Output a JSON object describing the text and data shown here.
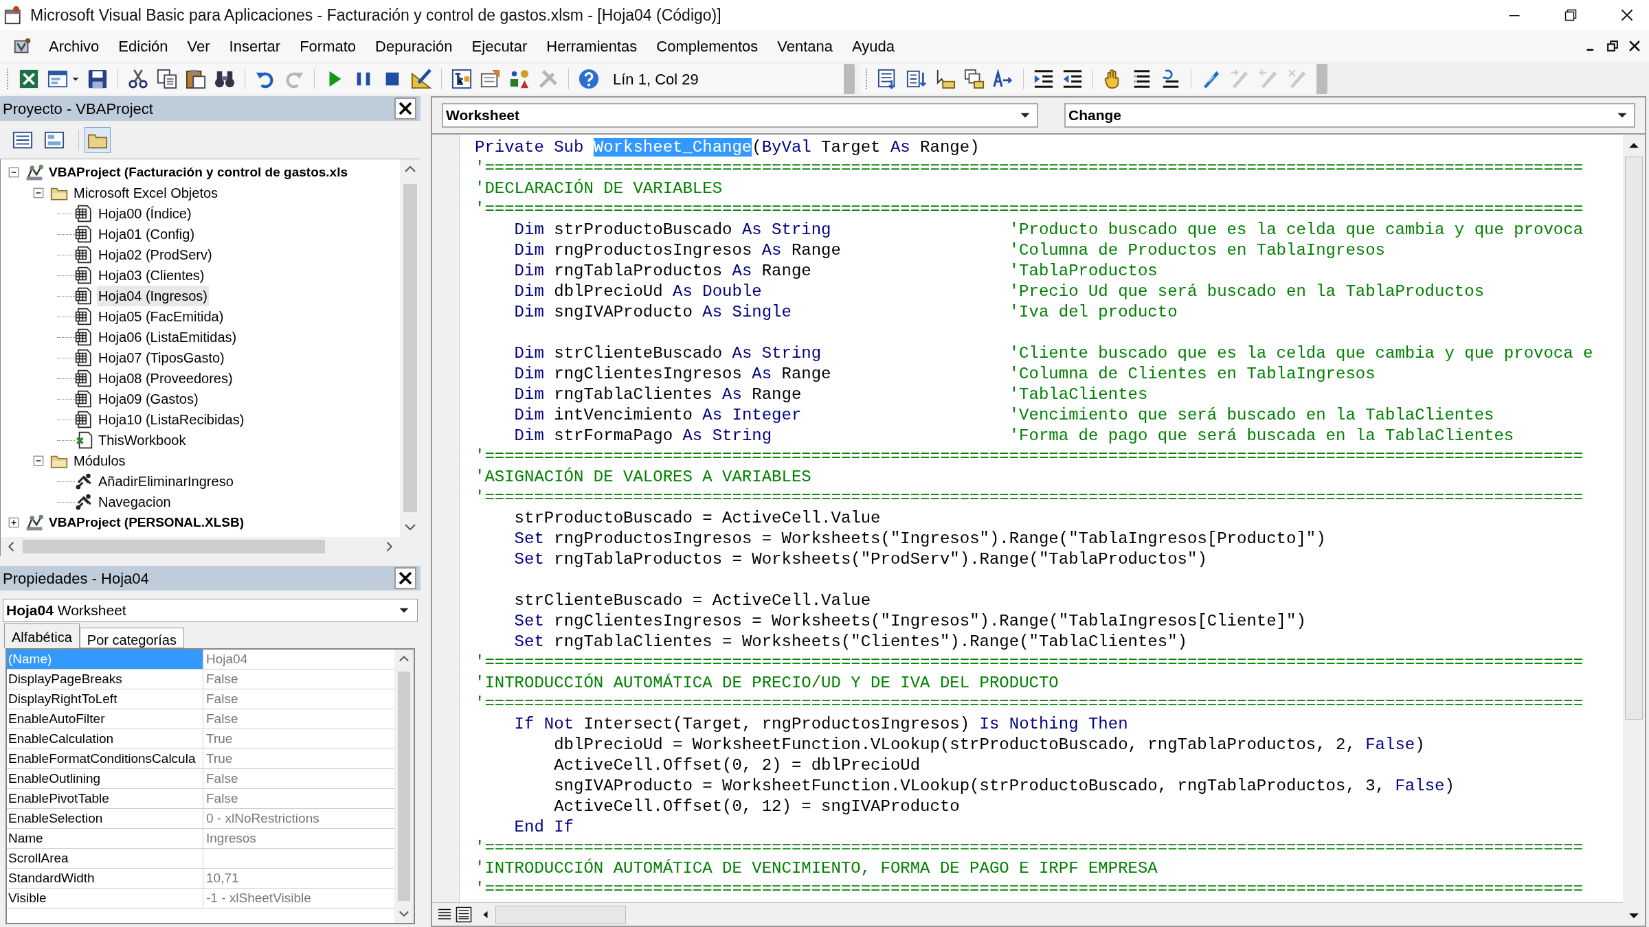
{
  "window": {
    "title": "Microsoft Visual Basic para Aplicaciones - Facturación y control de gastos.xlsm - [Hoja04 (Código)]"
  },
  "menu": [
    "Archivo",
    "Edición",
    "Ver",
    "Insertar",
    "Formato",
    "Depuración",
    "Ejecutar",
    "Herramientas",
    "Complementos",
    "Ventana",
    "Ayuda"
  ],
  "toolbar": {
    "standard": [
      {
        "disabled": false
      },
      {
        "disabled": false
      },
      {
        "disabled": false
      },
      {
        "disabled": false
      },
      {
        "disabled": false
      },
      {
        "disabled": false
      },
      {
        "disabled": false
      },
      {
        "disabled": false
      },
      {
        "disabled": true
      },
      {
        "disabled": false
      },
      {
        "disabled": false
      },
      {
        "disabled": false
      },
      {
        "disabled": false
      },
      {
        "disabled": false
      },
      {
        "disabled": false
      },
      {
        "disabled": false
      },
      {
        "disabled": true
      },
      {
        "disabled": false
      }
    ],
    "position": "Lín 1, Col 29",
    "edit": [
      {
        "disabled": false
      },
      {
        "disabled": false
      },
      {
        "disabled": false
      },
      {
        "disabled": false
      },
      {
        "disabled": false
      },
      {
        "disabled": false
      },
      {
        "disabled": false
      },
      {
        "disabled": false
      },
      {
        "disabled": false
      },
      {
        "disabled": false
      },
      {
        "disabled": false
      },
      {
        "disabled": true
      },
      {
        "disabled": true
      },
      {
        "disabled": true
      }
    ]
  },
  "project": {
    "title": "Proyecto - VBAProject",
    "buttons": [
      {
        "selected": false
      },
      {
        "selected": false
      },
      {
        "selected": true
      }
    ],
    "tree": [
      {
        "kind": "project",
        "label": "VBAProject (Facturación y control de gastos.xls",
        "expanded": true,
        "selected": false,
        "children": [
          {
            "kind": "folder",
            "label": "Microsoft Excel Objetos",
            "expanded": true,
            "selected": false,
            "children": [
              {
                "kind": "sheet",
                "label": "Hoja00 (Índice)",
                "selected": false
              },
              {
                "kind": "sheet",
                "label": "Hoja01 (Config)",
                "selected": false
              },
              {
                "kind": "sheet",
                "label": "Hoja02 (ProdServ)",
                "selected": false
              },
              {
                "kind": "sheet",
                "label": "Hoja03 (Clientes)",
                "selected": false
              },
              {
                "kind": "sheet",
                "label": "Hoja04 (Ingresos)",
                "selected": true
              },
              {
                "kind": "sheet",
                "label": "Hoja05 (FacEmitida)",
                "selected": false
              },
              {
                "kind": "sheet",
                "label": "Hoja06 (ListaEmitidas)",
                "selected": false
              },
              {
                "kind": "sheet",
                "label": "Hoja07 (TiposGasto)",
                "selected": false
              },
              {
                "kind": "sheet",
                "label": "Hoja08 (Proveedores)",
                "selected": false
              },
              {
                "kind": "sheet",
                "label": "Hoja09 (Gastos)",
                "selected": false
              },
              {
                "kind": "sheet",
                "label": "Hoja10 (ListaRecibidas)",
                "selected": false
              },
              {
                "kind": "workbook",
                "label": "ThisWorkbook",
                "selected": false
              }
            ]
          },
          {
            "kind": "folder",
            "label": "Módulos",
            "expanded": true,
            "selected": false,
            "children": [
              {
                "kind": "module",
                "label": "AñadirEliminarIngreso",
                "selected": false
              },
              {
                "kind": "module",
                "label": "Navegacion",
                "selected": false
              }
            ]
          }
        ]
      },
      {
        "kind": "project",
        "label": "VBAProject (PERSONAL.XLSB)",
        "expanded": false,
        "selected": false
      }
    ]
  },
  "properties": {
    "title": "Propiedades - Hoja04",
    "object": {
      "name": "Hoja04",
      "type": "Worksheet"
    },
    "tabs": [
      {
        "label": "Alfabética",
        "selected": true
      },
      {
        "label": "Por categorías",
        "selected": false
      }
    ],
    "rows": [
      {
        "name": "(Name)",
        "value": "Hoja04",
        "selected": true
      },
      {
        "name": "DisplayPageBreaks",
        "value": "False",
        "selected": false
      },
      {
        "name": "DisplayRightToLeft",
        "value": "False",
        "selected": false
      },
      {
        "name": "EnableAutoFilter",
        "value": "False",
        "selected": false
      },
      {
        "name": "EnableCalculation",
        "value": "True",
        "selected": false
      },
      {
        "name": "EnableFormatConditionsCalcula",
        "value": "True",
        "selected": false
      },
      {
        "name": "EnableOutlining",
        "value": "False",
        "selected": false
      },
      {
        "name": "EnablePivotTable",
        "value": "False",
        "selected": false
      },
      {
        "name": "EnableSelection",
        "value": "0 - xlNoRestrictions",
        "selected": false
      },
      {
        "name": "Name",
        "value": "Ingresos",
        "selected": false
      },
      {
        "name": "ScrollArea",
        "selected": false
      },
      {
        "name": "StandardWidth",
        "value": "10,71",
        "selected": false
      },
      {
        "name": "Visible",
        "value": "-1 - xlSheetVisible",
        "selected": false
      }
    ]
  },
  "code": {
    "object": "Worksheet",
    "procedure": "Change",
    "lines": [
      {
        "kind": "code",
        "segments": [
          {
            "kind": "keyword",
            "text": "Private Sub "
          },
          {
            "kind": "selected",
            "text": "Worksheet_Change"
          },
          {
            "kind": "plain",
            "text": "("
          },
          {
            "kind": "keyword",
            "text": "ByVal"
          },
          {
            "kind": "plain",
            "text": " Target "
          },
          {
            "kind": "keyword",
            "text": "As"
          },
          {
            "kind": "plain",
            "text": " Range)"
          }
        ]
      },
      {
        "kind": "comment",
        "text": "'==============================================================================================================="
      },
      {
        "kind": "comment",
        "text": "'DECLARACIÓN DE VARIABLES"
      },
      {
        "kind": "comment",
        "text": "'==============================================================================================================="
      },
      {
        "kind": "code",
        "segments": [
          {
            "kind": "keyword",
            "text": "    Dim"
          },
          {
            "kind": "plain",
            "text": " strProductoBuscado "
          },
          {
            "kind": "keyword",
            "text": "As String"
          }
        ],
        "comment": "'Producto buscado que es la celda que cambia y que provoca"
      },
      {
        "kind": "code",
        "segments": [
          {
            "kind": "keyword",
            "text": "    Dim"
          },
          {
            "kind": "plain",
            "text": " rngProductosIngresos "
          },
          {
            "kind": "keyword",
            "text": "As"
          },
          {
            "kind": "plain",
            "text": " Range"
          }
        ],
        "comment": "'Columna de Productos en TablaIngresos"
      },
      {
        "kind": "code",
        "segments": [
          {
            "kind": "keyword",
            "text": "    Dim"
          },
          {
            "kind": "plain",
            "text": " rngTablaProductos "
          },
          {
            "kind": "keyword",
            "text": "As"
          },
          {
            "kind": "plain",
            "text": " Range"
          }
        ],
        "comment": "'TablaProductos"
      },
      {
        "kind": "code",
        "segments": [
          {
            "kind": "keyword",
            "text": "    Dim"
          },
          {
            "kind": "plain",
            "text": " dblPrecioUd "
          },
          {
            "kind": "keyword",
            "text": "As Double"
          }
        ],
        "comment": "'Precio Ud que será buscado en la TablaProductos"
      },
      {
        "kind": "code",
        "segments": [
          {
            "kind": "keyword",
            "text": "    Dim"
          },
          {
            "kind": "plain",
            "text": " sngIVAProducto "
          },
          {
            "kind": "keyword",
            "text": "As Single"
          }
        ],
        "comment": "'Iva del producto"
      },
      {
        "kind": "blank"
      },
      {
        "kind": "code",
        "segments": [
          {
            "kind": "keyword",
            "text": "    Dim"
          },
          {
            "kind": "plain",
            "text": " strClienteBuscado "
          },
          {
            "kind": "keyword",
            "text": "As String"
          }
        ],
        "comment": "'Cliente buscado que es la celda que cambia y que provoca e"
      },
      {
        "kind": "code",
        "segments": [
          {
            "kind": "keyword",
            "text": "    Dim"
          },
          {
            "kind": "plain",
            "text": " rngClientesIngresos "
          },
          {
            "kind": "keyword",
            "text": "As"
          },
          {
            "kind": "plain",
            "text": " Range"
          }
        ],
        "comment": "'Columna de Clientes en TablaIngresos"
      },
      {
        "kind": "code",
        "segments": [
          {
            "kind": "keyword",
            "text": "    Dim"
          },
          {
            "kind": "plain",
            "text": " rngTablaClientes "
          },
          {
            "kind": "keyword",
            "text": "As"
          },
          {
            "kind": "plain",
            "text": " Range"
          }
        ],
        "comment": "'TablaClientes"
      },
      {
        "kind": "code",
        "segments": [
          {
            "kind": "keyword",
            "text": "    Dim"
          },
          {
            "kind": "plain",
            "text": " intVencimiento "
          },
          {
            "kind": "keyword",
            "text": "As Integer"
          }
        ],
        "comment": "'Vencimiento que será buscado en la TablaClientes"
      },
      {
        "kind": "code",
        "segments": [
          {
            "kind": "keyword",
            "text": "    Dim"
          },
          {
            "kind": "plain",
            "text": " strFormaPago "
          },
          {
            "kind": "keyword",
            "text": "As String"
          }
        ],
        "comment": "'Forma de pago que será buscada en la TablaClientes"
      },
      {
        "kind": "comment",
        "text": "'==============================================================================================================="
      },
      {
        "kind": "comment",
        "text": "'ASIGNACIÓN DE VALORES A VARIABLES"
      },
      {
        "kind": "comment",
        "text": "'==============================================================================================================="
      },
      {
        "kind": "code",
        "segments": [
          {
            "kind": "plain",
            "text": "    strProductoBuscado = ActiveCell.Value"
          }
        ]
      },
      {
        "kind": "code",
        "segments": [
          {
            "kind": "keyword",
            "text": "    Set"
          },
          {
            "kind": "plain",
            "text": " rngProductosIngresos = Worksheets(\"Ingresos\").Range(\"TablaIngresos[Producto]\")"
          }
        ]
      },
      {
        "kind": "code",
        "segments": [
          {
            "kind": "keyword",
            "text": "    Set"
          },
          {
            "kind": "plain",
            "text": " rngTablaProductos = Worksheets(\"ProdServ\").Range(\"TablaProductos\")"
          }
        ]
      },
      {
        "kind": "blank"
      },
      {
        "kind": "code",
        "segments": [
          {
            "kind": "plain",
            "text": "    strClienteBuscado = ActiveCell.Value"
          }
        ]
      },
      {
        "kind": "code",
        "segments": [
          {
            "kind": "keyword",
            "text": "    Set"
          },
          {
            "kind": "plain",
            "text": " rngClientesIngresos = Worksheets(\"Ingresos\").Range(\"TablaIngresos[Cliente]\")"
          }
        ]
      },
      {
        "kind": "code",
        "segments": [
          {
            "kind": "keyword",
            "text": "    Set"
          },
          {
            "kind": "plain",
            "text": " rngTablaClientes = Worksheets(\"Clientes\").Range(\"TablaClientes\")"
          }
        ]
      },
      {
        "kind": "comment",
        "text": "'==============================================================================================================="
      },
      {
        "kind": "comment",
        "text": "'INTRODUCCIÓN AUTOMÁTICA DE PRECIO/UD Y DE IVA DEL PRODUCTO"
      },
      {
        "kind": "comment",
        "text": "'==============================================================================================================="
      },
      {
        "kind": "code",
        "segments": [
          {
            "kind": "keyword",
            "text": "    If Not"
          },
          {
            "kind": "plain",
            "text": " Intersect(Target, rngProductosIngresos) "
          },
          {
            "kind": "keyword",
            "text": "Is Nothing Then"
          }
        ]
      },
      {
        "kind": "code",
        "segments": [
          {
            "kind": "plain",
            "text": "        dblPrecioUd = WorksheetFunction.VLookup(strProductoBuscado, rngTablaProductos, 2, "
          },
          {
            "kind": "keyword",
            "text": "False"
          },
          {
            "kind": "plain",
            "text": ")"
          }
        ]
      },
      {
        "kind": "code",
        "segments": [
          {
            "kind": "plain",
            "text": "        ActiveCell.Offset(0, 2) = dblPrecioUd"
          }
        ]
      },
      {
        "kind": "code",
        "segments": [
          {
            "kind": "plain",
            "text": "        sngIVAProducto = WorksheetFunction.VLookup(strProductoBuscado, rngTablaProductos, 3, "
          },
          {
            "kind": "keyword",
            "text": "False"
          },
          {
            "kind": "plain",
            "text": ")"
          }
        ]
      },
      {
        "kind": "code",
        "segments": [
          {
            "kind": "plain",
            "text": "        ActiveCell.Offset(0, 12) = sngIVAProducto"
          }
        ]
      },
      {
        "kind": "code",
        "segments": [
          {
            "kind": "keyword",
            "text": "    End If"
          }
        ]
      },
      {
        "kind": "comment",
        "text": "'==============================================================================================================="
      },
      {
        "kind": "comment",
        "text": "'INTRODUCCIÓN AUTOMÁTICA DE VENCIMIENTO, FORMA DE PAGO E IRPF EMPRESA"
      },
      {
        "kind": "comment",
        "text": "'==============================================================================================================="
      }
    ]
  }
}
